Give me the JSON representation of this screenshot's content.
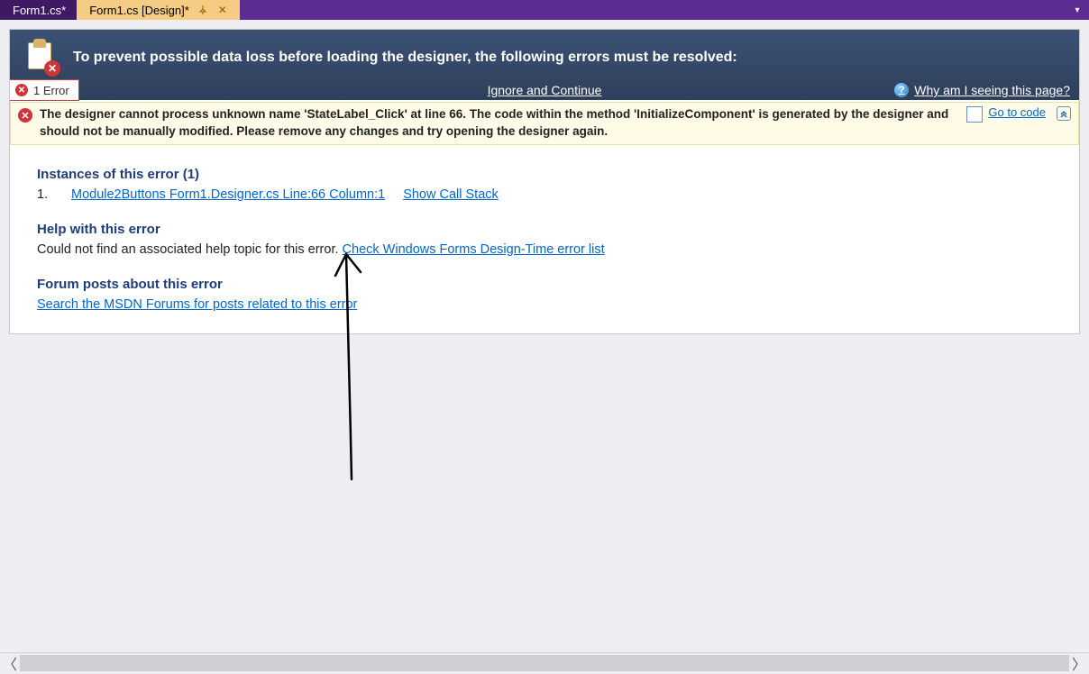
{
  "tabs": {
    "inactive": "Form1.cs*",
    "active": "Form1.cs [Design]*"
  },
  "banner": {
    "text": "To prevent possible data loss before loading the designer, the following errors must be resolved:"
  },
  "actionbar": {
    "error_count": "1 Error",
    "ignore": "Ignore and Continue",
    "why": "Why am I seeing this page?"
  },
  "error": {
    "message": "The designer cannot process unknown name 'StateLabel_Click' at line 66. The code within the method 'InitializeComponent' is generated by the designer and should not be manually modified. Please remove any changes and try opening the designer again.",
    "goto": "Go to code"
  },
  "details": {
    "instances_heading": "Instances of this error (1)",
    "instance_num": "1.",
    "instance_link": "Module2Buttons Form1.Designer.cs Line:66 Column:1",
    "callstack": "Show Call Stack",
    "help_heading": "Help with this error",
    "help_text": "Could not find an associated help topic for this error. ",
    "help_link": "Check Windows Forms Design-Time error list",
    "forum_heading": "Forum posts about this error",
    "forum_link": "Search the MSDN Forums for posts related to this error"
  }
}
